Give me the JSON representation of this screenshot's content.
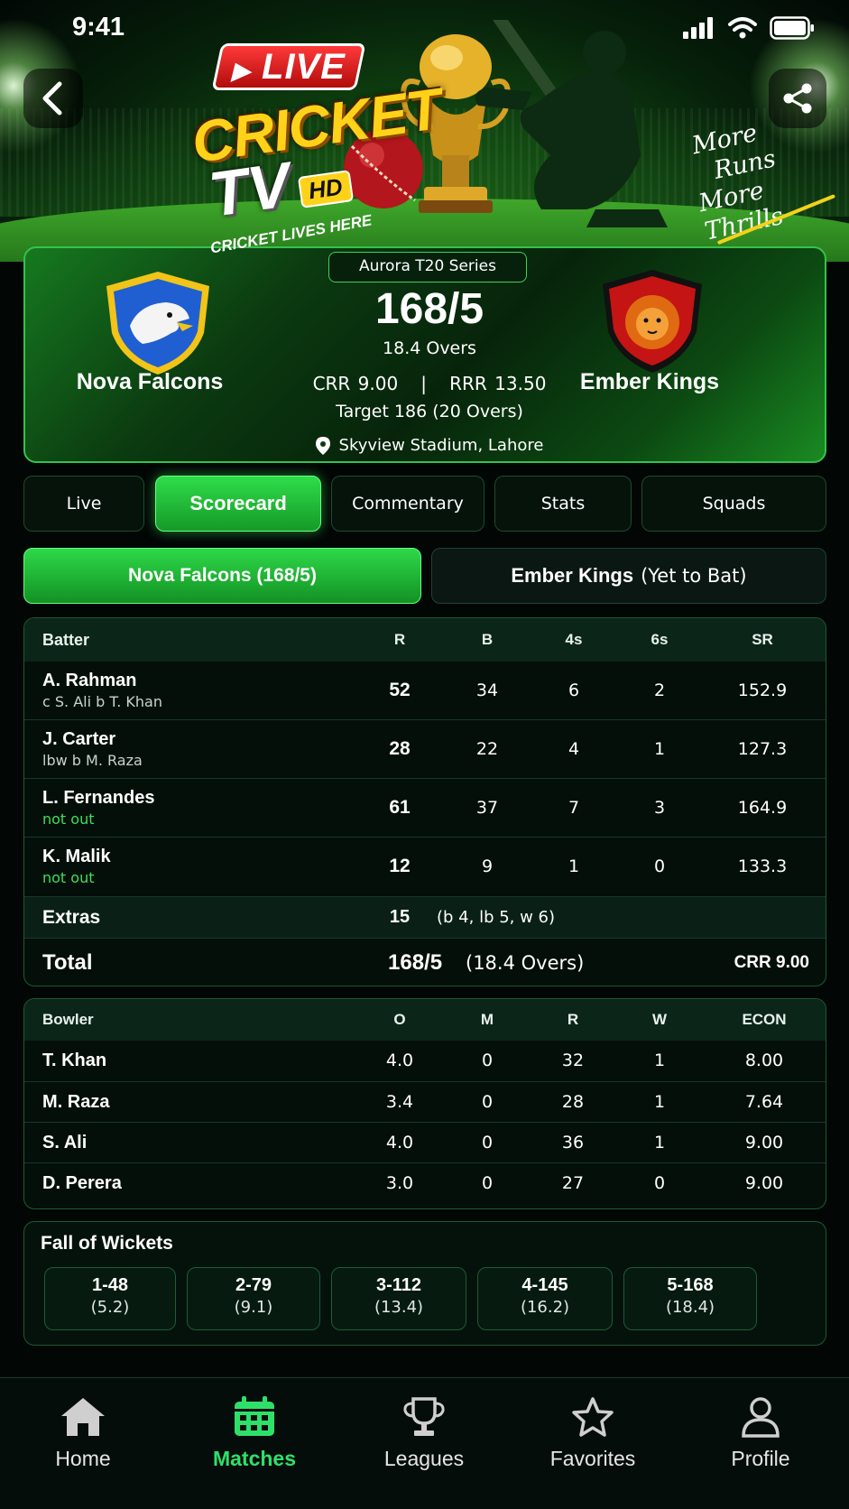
{
  "status_bar": {
    "time": "9:41"
  },
  "hero": {
    "logo_live": "LIVE",
    "logo_cricket": "CRICKET",
    "logo_tv": "TV",
    "logo_hd": "HD",
    "logo_tagline": "CRICKET LIVES HERE",
    "slogan": [
      "More",
      "Runs",
      "More Thrills"
    ],
    "back_icon": "chevron-left-icon",
    "share_icon": "share-icon"
  },
  "match": {
    "series": "Aurora T20 Series",
    "team_a": {
      "name": "Nova Falcons",
      "badge_color": "#1f5fd1",
      "accent": "#f2c418"
    },
    "team_b": {
      "name": "Ember Kings",
      "badge_color": "#c41414",
      "accent": "#111111"
    },
    "score": "168/5",
    "overs": "18.4 Overs",
    "crr": "CRR 9.00",
    "divider": "|",
    "rrr": "RRR 13.50",
    "target": "Target 186 (20 Overs)",
    "venue": "Skyview Stadium, Lahore"
  },
  "tabs": [
    {
      "label": "Live",
      "active": false
    },
    {
      "label": "Scorecard",
      "active": true
    },
    {
      "label": "Commentary",
      "active": false
    },
    {
      "label": "Stats",
      "active": false
    },
    {
      "label": "Squads",
      "active": false
    }
  ],
  "innings_tabs": {
    "active": "Nova Falcons (168/5)",
    "other_team": "Ember Kings",
    "other_status": "(Yet to Bat)"
  },
  "batting": {
    "headers": [
      "Batter",
      "R",
      "B",
      "4s",
      "6s",
      "SR"
    ],
    "rows": [
      {
        "name": "A. Rahman",
        "dismissal": "c S. Ali b T. Khan",
        "not_out": false,
        "r": "52",
        "b": "34",
        "fours": "6",
        "sixes": "2",
        "sr": "152.9"
      },
      {
        "name": "J. Carter",
        "dismissal": "lbw b M. Raza",
        "not_out": false,
        "r": "28",
        "b": "22",
        "fours": "4",
        "sixes": "1",
        "sr": "127.3"
      },
      {
        "name": "L. Fernandes",
        "dismissal": "not out",
        "not_out": true,
        "r": "61",
        "b": "37",
        "fours": "7",
        "sixes": "3",
        "sr": "164.9"
      },
      {
        "name": "K. Malik",
        "dismissal": "not out",
        "not_out": true,
        "r": "12",
        "b": "9",
        "fours": "1",
        "sixes": "0",
        "sr": "133.3"
      }
    ],
    "extras_label": "Extras",
    "extras_value": "15",
    "extras_detail": "(b 4, lb 5, w 6)",
    "total_label": "Total",
    "total_value": "168/5",
    "total_overs": "(18.4 Overs)",
    "total_crr": "CRR 9.00"
  },
  "bowling": {
    "headers": [
      "Bowler",
      "O",
      "M",
      "R",
      "W",
      "ECON"
    ],
    "rows": [
      {
        "name": "T. Khan",
        "o": "4.0",
        "m": "0",
        "r": "32",
        "w": "1",
        "econ": "8.00"
      },
      {
        "name": "M. Raza",
        "o": "3.4",
        "m": "0",
        "r": "28",
        "w": "1",
        "econ": "7.64"
      },
      {
        "name": "S. Ali",
        "o": "4.0",
        "m": "0",
        "r": "36",
        "w": "1",
        "econ": "9.00"
      },
      {
        "name": "D. Perera",
        "o": "3.0",
        "m": "0",
        "r": "27",
        "w": "0",
        "econ": "9.00"
      }
    ]
  },
  "fall_of_wickets": {
    "title": "Fall of Wickets",
    "items": [
      {
        "wicket": "1-48",
        "over": "(5.2)"
      },
      {
        "wicket": "2-79",
        "over": "(9.1)"
      },
      {
        "wicket": "3-112",
        "over": "(13.4)"
      },
      {
        "wicket": "4-145",
        "over": "(16.2)"
      },
      {
        "wicket": "5-168",
        "over": "(18.4)"
      }
    ]
  },
  "bottom_nav": [
    {
      "label": "Home",
      "icon": "home-icon",
      "active": false
    },
    {
      "label": "Matches",
      "icon": "calendar-icon",
      "active": true
    },
    {
      "label": "Leagues",
      "icon": "trophy-icon",
      "active": false
    },
    {
      "label": "Favorites",
      "icon": "star-icon",
      "active": false
    },
    {
      "label": "Profile",
      "icon": "user-icon",
      "active": false
    }
  ],
  "colors": {
    "accent": "#2ed849",
    "background": "#020605",
    "panel_border": "#1c5a34"
  }
}
